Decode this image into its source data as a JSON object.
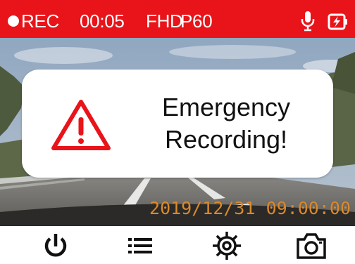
{
  "status_bar": {
    "rec_label": "REC",
    "elapsed": "00:05",
    "resolution": "FHD",
    "framerate": "P60",
    "bar_color": "#e8141a",
    "icons": [
      "record-dot-icon",
      "microphone-icon",
      "battery-charging-icon"
    ]
  },
  "dialog": {
    "line1": "Emergency",
    "line2": "Recording!",
    "icon": "warning-triangle-icon",
    "icon_color": "#e8141a"
  },
  "overlay": {
    "timestamp": "2019/12/31 09:00:00",
    "timestamp_color": "#d98a2e"
  },
  "toolbar": {
    "icons": [
      "power-icon",
      "menu-list-icon",
      "settings-gear-icon",
      "camera-snapshot-icon"
    ]
  }
}
